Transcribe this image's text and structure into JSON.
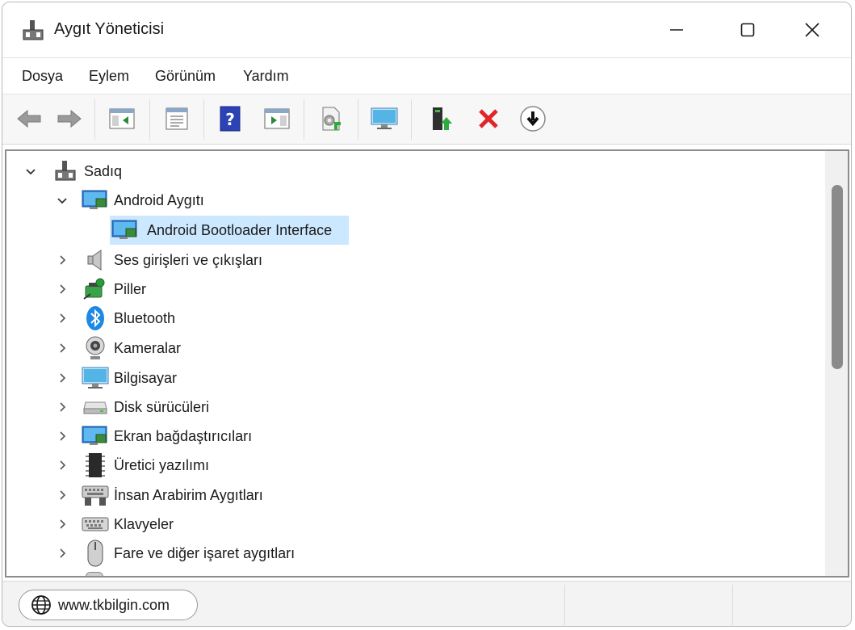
{
  "window": {
    "title": "Aygıt Yöneticisi"
  },
  "menu": [
    "Dosya",
    "Eylem",
    "Görünüm",
    "Yardım"
  ],
  "toolbar": {
    "buttons": [
      "back-arrow-icon",
      "forward-arrow-icon",
      "show-hide-console-tree-icon",
      "properties-icon",
      "help-icon",
      "show-action-pane-icon",
      "scan-hardware-changes-icon",
      "display-icon",
      "update-driver-icon",
      "uninstall-device-icon",
      "disable-device-icon"
    ]
  },
  "tree": {
    "root": "Sadıq",
    "expanded_category": "Android Aygıtı",
    "selected_child": "Android Bootloader Interface",
    "categories": [
      "Ses girişleri ve çıkışları",
      "Piller",
      "Bluetooth",
      "Kameralar",
      "Bilgisayar",
      "Disk sürücüleri",
      "Ekran bağdaştırıcıları",
      "Üretici yazılımı",
      "İnsan Arabirim Aygıtları",
      "Klavyeler",
      "Fare ve diğer işaret aygıtları"
    ]
  },
  "status": {
    "url": "www.tkbilgin.com"
  },
  "colors": {
    "selection": "#cce8ff",
    "accent_blue": "#2f7fdc",
    "close_red": "#e0262a"
  }
}
